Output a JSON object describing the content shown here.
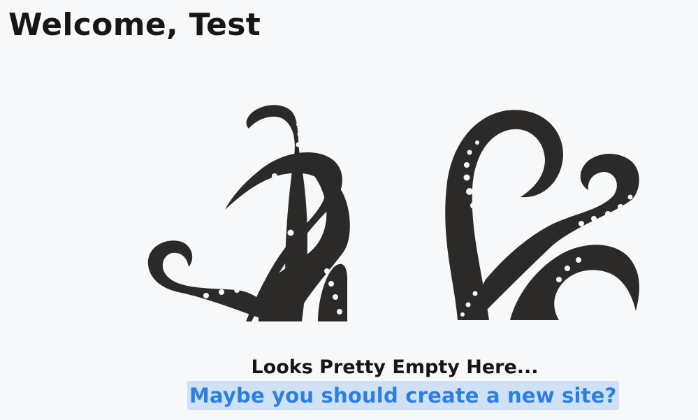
{
  "header": {
    "welcome_text": "Welcome, Test"
  },
  "empty_state": {
    "illustration_icon": "octopus-tentacles-icon",
    "title": "Looks Pretty Empty Here...",
    "cta_link": "Maybe you should create a new site?"
  },
  "colors": {
    "background": "#f7f8fa",
    "text": "#161616",
    "link": "#2b7fe0",
    "link_highlight": "#cfe0f7",
    "illustration": "#2b2a29"
  }
}
